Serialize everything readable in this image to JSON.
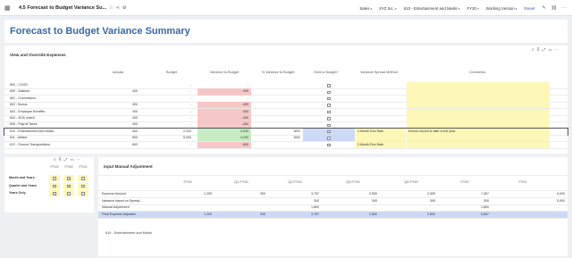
{
  "header": {
    "title": "4.5 Forecast to Budget Variance Su...",
    "filters": [
      "Sales",
      "XYZ Inc.",
      "610 - Entertainment and Meals",
      "FY20",
      "Working Version"
    ],
    "reset_label": "Reset"
  },
  "page_title": "Forecast to Budget Variance Summary",
  "view_panel": {
    "title": "View and Override Expenses",
    "columns": [
      "Actuals",
      "Budget",
      "Variance to Budget",
      "% Variance to Budget",
      "Hold to Budget?",
      "Variance Spread Method",
      "Comments"
    ],
    "rows": [
      {
        "label": "500 - COGS",
        "actuals": "",
        "budget": "-",
        "variance": "-",
        "pct": "",
        "hold": false,
        "spread": "",
        "comment": ""
      },
      {
        "label": "600 - Salaries",
        "actuals": "400",
        "budget": "-",
        "variance": "-400",
        "pct": "",
        "hold": false,
        "spread": "",
        "comment": ""
      },
      {
        "label": "601 - Commission",
        "actuals": "",
        "budget": "-",
        "variance": "-",
        "pct": "",
        "hold": false,
        "spread": "",
        "comment": ""
      },
      {
        "label": "602 - Bonus",
        "actuals": "400",
        "budget": "-",
        "variance": "-400",
        "pct": "",
        "hold": false,
        "spread": "",
        "comment": ""
      },
      {
        "label": "603 - Employee Benefits",
        "actuals": "400",
        "budget": "-",
        "variance": "-400",
        "pct": "",
        "hold": false,
        "spread": "",
        "comment": ""
      },
      {
        "label": "604 - 401k match",
        "actuals": "400",
        "budget": "-",
        "variance": "-400",
        "pct": "",
        "hold": false,
        "spread": "",
        "comment": ""
      },
      {
        "label": "605 - Payroll Taxes",
        "actuals": "400",
        "budget": "-",
        "variance": "-400",
        "pct": "",
        "hold": false,
        "spread": "",
        "comment": ""
      },
      {
        "label": "610 - Entertainment and Meals",
        "actuals": "400",
        "budget": "2,333",
        "variance": "2,933",
        "pct": "80%",
        "hold": false,
        "spread": "3 Month Run Rate",
        "comment": "Events moved to later in the year"
      },
      {
        "label": "611 - Airfare",
        "actuals": "800",
        "budget": "5,000",
        "variance": "4,200",
        "pct": "84%",
        "hold": false,
        "spread": "",
        "comment": ""
      },
      {
        "label": "612 - Ground Transportation",
        "actuals": "800",
        "budget": "-",
        "variance": "-800",
        "pct": "",
        "hold": false,
        "spread": "3 Month Run Rate",
        "comment": ""
      }
    ]
  },
  "small_panel": {
    "columns": [
      "FY19",
      "FY20",
      "FY21"
    ],
    "rows": [
      {
        "label": "Month and Years",
        "checks": [
          false,
          true,
          false
        ]
      },
      {
        "label": "Quarter and Years",
        "checks": [
          false,
          true,
          false
        ]
      },
      {
        "label": "Years Only",
        "checks": [
          false,
          false,
          false
        ]
      }
    ]
  },
  "input_panel": {
    "title": "Input Manual Adjustment",
    "columns": [
      "FY19",
      "Q1 FY20",
      "Q2 FY20",
      "Q3 FY20",
      "Q4 FY20",
      "FY20",
      "FY21"
    ],
    "rows": [
      {
        "label": "Expense Amount",
        "values": [
          "1,200",
          "300",
          "3,767",
          "2,500",
          "2,500",
          "7,067",
          ""
        ],
        "extra": "5,000"
      },
      {
        "label": "Variance based on Spread...",
        "values": [
          "",
          "",
          "300",
          "300",
          "300",
          "300",
          ""
        ],
        "extra": "5,000"
      },
      {
        "label": "Manual Adjustment",
        "values": [
          "",
          "",
          "1,800",
          "",
          "",
          "1,800",
          ""
        ],
        "extra": ""
      },
      {
        "label": "Final Expense Adjusted",
        "values": [
          "1,200",
          "300",
          "3,767",
          "2,800",
          "2,800",
          "9,667",
          ""
        ],
        "extra": ""
      }
    ],
    "footer_label": "610 - Entertainment and Meals"
  }
}
